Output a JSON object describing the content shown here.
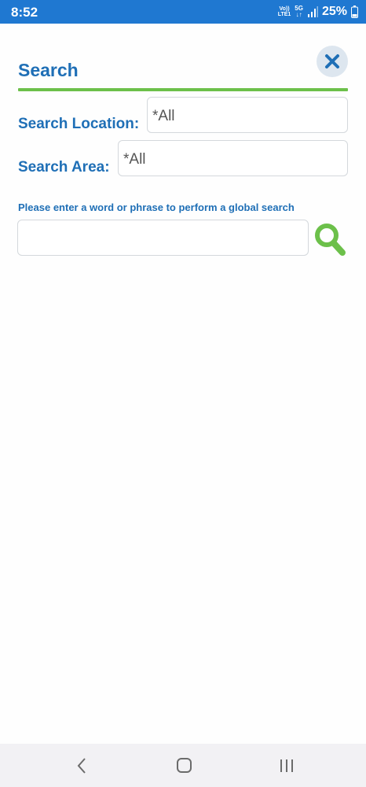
{
  "status_bar": {
    "time": "8:52",
    "network_lte": "Vo)) LTE1",
    "network_5g": "5G ↓↑",
    "battery_percent": "25%"
  },
  "header": {
    "title": "Search",
    "close_icon": "close-icon"
  },
  "form": {
    "location_label": "Search Location:",
    "location_value": "*All",
    "area_label": "Search Area:",
    "area_value": "*All",
    "global_hint": "Please enter a word or phrase to perform a global search",
    "global_search_value": "",
    "search_icon": "search-icon"
  },
  "nav": {
    "back_icon": "back-icon",
    "home_icon": "home-icon",
    "recents_icon": "recents-icon"
  },
  "colors": {
    "status_bar": "#1f78d1",
    "label_blue": "#1f6fb6",
    "accent_green": "#6cc04a",
    "close_bg": "#dde6ef"
  }
}
